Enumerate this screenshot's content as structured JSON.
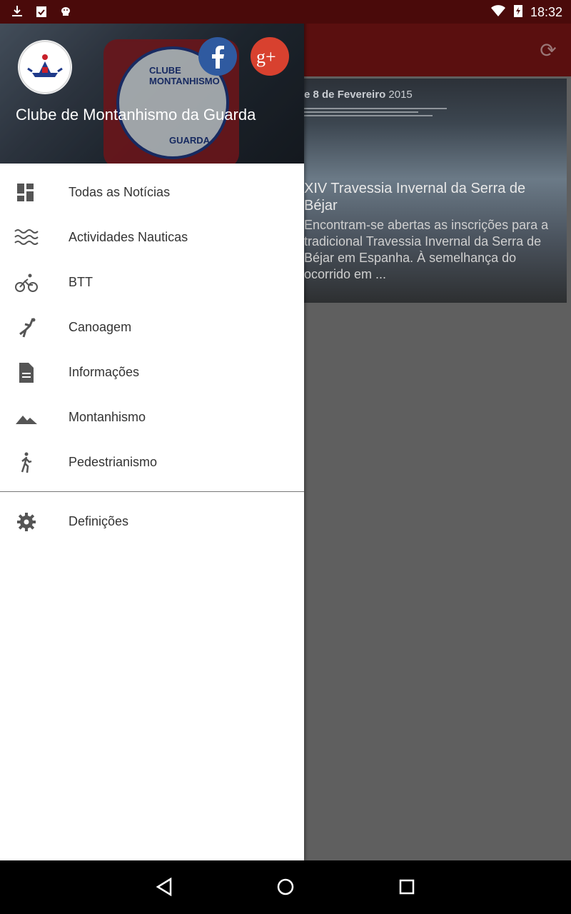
{
  "status_bar": {
    "time": "18:32"
  },
  "header": {
    "club_name": "Clube de Montanhismo da Guarda",
    "patch_top_text": "CLUBE MONTANHISMO",
    "patch_bottom_text": "GUARDA"
  },
  "menu": {
    "items": [
      {
        "label": "Todas as Notícias",
        "icon": "dashboard-icon"
      },
      {
        "label": "Actividades Nauticas",
        "icon": "waves-icon"
      },
      {
        "label": "BTT",
        "icon": "bike-icon"
      },
      {
        "label": "Canoagem",
        "icon": "canoe-icon"
      },
      {
        "label": "Informações",
        "icon": "document-icon"
      },
      {
        "label": "Montanhismo",
        "icon": "mountain-icon"
      },
      {
        "label": "Pedestrianismo",
        "icon": "walk-icon"
      }
    ],
    "settings": {
      "label": "Definições",
      "icon": "gear-icon"
    }
  },
  "card": {
    "banner_text": "e 8 de Fevereiro",
    "banner_year": "2015",
    "title": "XIV Travessia Invernal da Serra de Béjar",
    "excerpt": "Encontram-se abertas as inscrições para a tradicional Travessia Invernal da Serra de Béjar em Espanha. À semelhança do ocorrido em ..."
  },
  "colors": {
    "appbar": "#5a0f0f",
    "facebook": "#2f5aa0",
    "google_plus": "#d8412f"
  }
}
